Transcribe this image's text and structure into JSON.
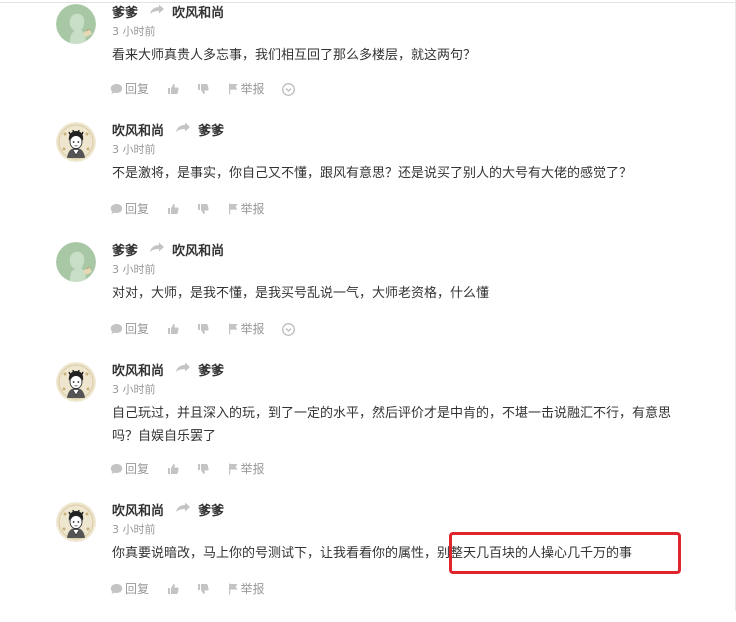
{
  "comments": [
    {
      "author": "爹爹",
      "reply_to": "吹风和尚",
      "time": "3 小时前",
      "text": "看来大师真贵人多忘事，我们相互回了那么多楼层，就这两句？",
      "reply_label": "回复",
      "report_label": "举报",
      "avatar": "default-avatar-icon"
    },
    {
      "author": "吹风和尚",
      "reply_to": "爹爹",
      "time": "3 小时前",
      "text": "不是激将，是事实，你自己又不懂，跟风有意思？还是说买了别人的大号有大佬的感觉了？",
      "reply_label": "回复",
      "report_label": "举报",
      "avatar": "cartoon-avatar-icon"
    },
    {
      "author": "爹爹",
      "reply_to": "吹风和尚",
      "time": "3 小时前",
      "text": "对对，大师，是我不懂，是我买号乱说一气，大师老资格，什么懂",
      "reply_label": "回复",
      "report_label": "举报",
      "avatar": "default-avatar-icon"
    },
    {
      "author": "吹风和尚",
      "reply_to": "爹爹",
      "time": "3 小时前",
      "text": "自己玩过，并且深入的玩，到了一定的水平，然后评价才是中肯的，不堪一击说融汇不行，有意思吗？自娱自乐罢了",
      "reply_label": "回复",
      "report_label": "举报",
      "avatar": "cartoon-avatar-icon"
    },
    {
      "author": "吹风和尚",
      "reply_to": "爹爹",
      "time": "3 小时前",
      "text": "你真要说暗改，马上你的号测试下，让我看看你的属性，别整天几百块的人操心几千万的事",
      "reply_label": "回复",
      "report_label": "举报",
      "avatar": "cartoon-avatar-icon"
    }
  ],
  "colors": {
    "highlight": "#e0242b",
    "muted": "#999999",
    "text": "#333333",
    "default_avatar_bg": "#a8c7a5"
  }
}
